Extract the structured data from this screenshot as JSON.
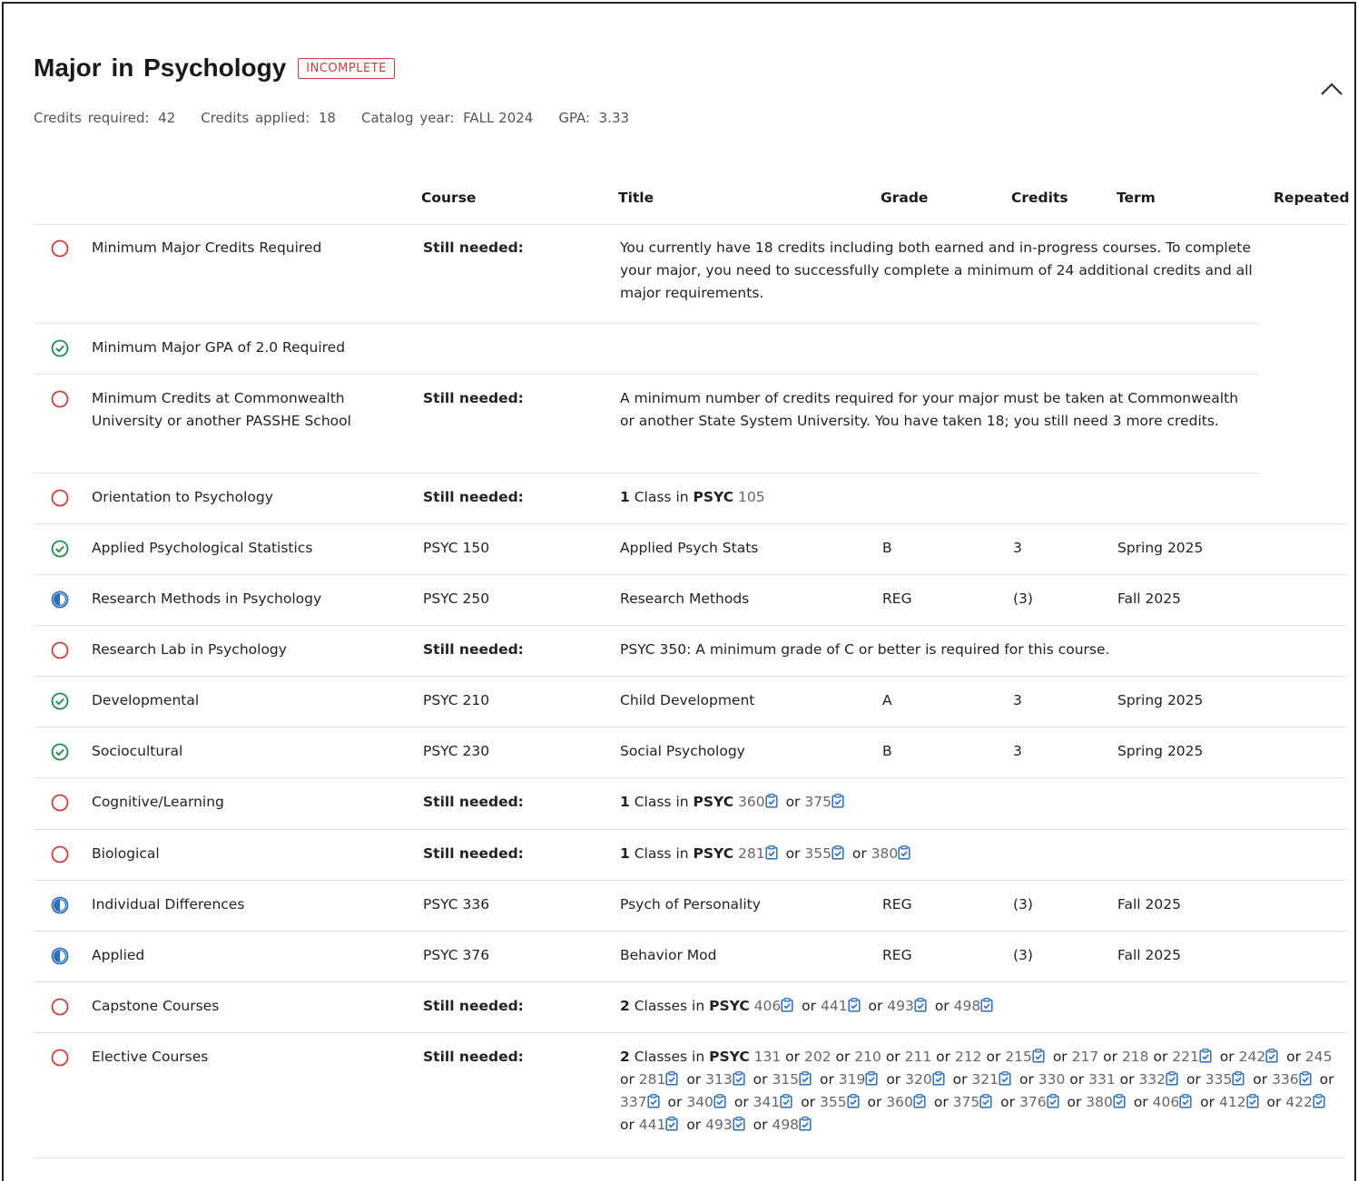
{
  "header": {
    "title": "Major in Psychology",
    "status_badge": "INCOMPLETE",
    "credits_required_label": "Credits required:",
    "credits_required": "42",
    "credits_applied_label": "Credits applied:",
    "credits_applied": "18",
    "catalog_year_label": "Catalog year:",
    "catalog_year": "FALL 2024",
    "gpa_label": "GPA:",
    "gpa": "3.33"
  },
  "columns": {
    "course": "Course",
    "title": "Title",
    "grade": "Grade",
    "credits": "Credits",
    "term": "Term",
    "repeated": "Repeated"
  },
  "still_needed_label": "Still needed:",
  "or_label": "or",
  "colors": {
    "incomplete": "#d23b3b",
    "complete": "#1e8a4c",
    "in_progress": "#2a6fb8"
  },
  "rows": [
    {
      "status": "incomplete",
      "requirement": "Minimum Major Credits Required",
      "description": "You currently have 18 credits including both earned and in-progress courses. To complete your major, you need to successfully complete a minimum of 24 additional credits and all major requirements."
    },
    {
      "status": "complete",
      "requirement": "Minimum Major GPA of 2.0 Required"
    },
    {
      "status": "incomplete",
      "requirement": "Minimum Credits at Commonwealth University or another PASSHE School",
      "description": "A minimum number of credits required for your major must be taken at Commonwealth or another State System University. You have taken 18; you still need 3 more credits."
    },
    {
      "status": "incomplete",
      "requirement": "Orientation to Psychology",
      "needed": {
        "count": "1",
        "unit": "Class in",
        "subject": "PSYC",
        "options": [
          "105"
        ]
      }
    },
    {
      "status": "complete",
      "requirement": "Applied Psychological Statistics",
      "course": "PSYC 150",
      "title": "Applied Psych Stats",
      "grade": "B",
      "credits": "3",
      "term": "Spring 2025"
    },
    {
      "status": "in-progress",
      "requirement": "Research Methods in Psychology",
      "course": "PSYC 250",
      "title": "Research Methods",
      "grade": "REG",
      "credits": "(3)",
      "term": "Fall 2025"
    },
    {
      "status": "incomplete",
      "requirement": "Research Lab in Psychology",
      "description": "PSYC 350: A minimum grade of C or better is required for this course."
    },
    {
      "status": "complete",
      "requirement": "Developmental",
      "course": "PSYC 210",
      "title": "Child Development",
      "grade": "A",
      "credits": "3",
      "term": "Spring 2025"
    },
    {
      "status": "complete",
      "requirement": "Sociocultural",
      "course": "PSYC 230",
      "title": "Social Psychology",
      "grade": "B",
      "credits": "3",
      "term": "Spring 2025"
    },
    {
      "status": "incomplete",
      "requirement": "Cognitive/Learning",
      "needed": {
        "count": "1",
        "unit": "Class in",
        "subject": "PSYC",
        "options": [
          "360",
          "375"
        ]
      }
    },
    {
      "status": "incomplete",
      "requirement": "Biological",
      "needed": {
        "count": "1",
        "unit": "Class in",
        "subject": "PSYC",
        "options": [
          "281",
          "355",
          "380"
        ]
      }
    },
    {
      "status": "in-progress",
      "requirement": "Individual Differences",
      "course": "PSYC 336",
      "title": "Psych of Personality",
      "grade": "REG",
      "credits": "(3)",
      "term": "Fall 2025"
    },
    {
      "status": "in-progress",
      "requirement": "Applied",
      "course": "PSYC 376",
      "title": "Behavior Mod",
      "grade": "REG",
      "credits": "(3)",
      "term": "Fall 2025"
    },
    {
      "status": "incomplete",
      "requirement": "Capstone Courses",
      "needed": {
        "count": "2",
        "unit": "Classes in",
        "subject": "PSYC",
        "options": [
          "406",
          "441",
          "493",
          "498"
        ]
      }
    },
    {
      "status": "incomplete",
      "requirement": "Elective Courses",
      "needed": {
        "count": "2",
        "unit": "Classes in",
        "subject": "PSYC",
        "options": [
          "131",
          "202",
          "210",
          "211",
          "212",
          "215",
          "217",
          "218",
          "221",
          "242",
          "245",
          "281",
          "313",
          "315",
          "319",
          "320",
          "321",
          "330",
          "331",
          "332",
          "335",
          "336",
          "337",
          "340",
          "341",
          "355",
          "360",
          "375",
          "376",
          "380",
          "406",
          "412",
          "422",
          "441",
          "493",
          "498"
        ],
        "clip_options": [
          "215",
          "221",
          "242",
          "281",
          "313",
          "315",
          "319",
          "320",
          "321",
          "332",
          "335",
          "336",
          "337",
          "340",
          "341",
          "355",
          "360",
          "375",
          "376",
          "380",
          "406",
          "412",
          "422",
          "441",
          "493",
          "498"
        ]
      }
    }
  ]
}
